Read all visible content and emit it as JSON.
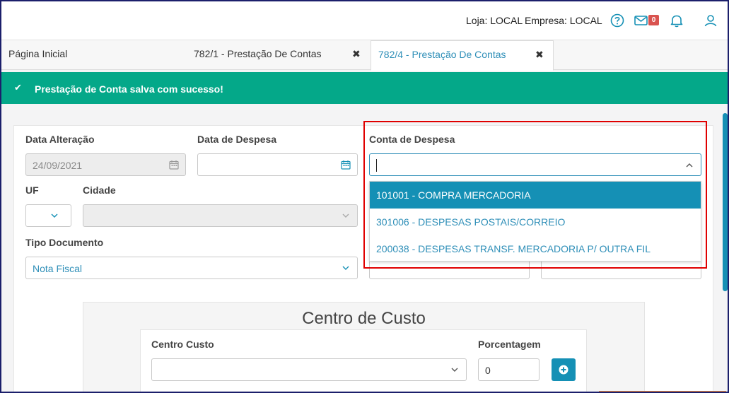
{
  "header": {
    "store_label": "Loja: LOCAL",
    "company_label": "Empresa: LOCAL",
    "mail_count": "0",
    "icons": [
      "help-icon",
      "mail-icon",
      "bell-icon",
      "user-icon"
    ]
  },
  "tabs": [
    {
      "label": "Página Inicial",
      "closable": false
    },
    {
      "label": "782/1 - Prestação De Contas",
      "closable": true
    },
    {
      "label": "782/4 - Prestação De Contas",
      "closable": true,
      "active": true
    }
  ],
  "banner": {
    "message": "Prestação de Conta salva com sucesso!",
    "color": "#04a889"
  },
  "form": {
    "data_alteracao_label": "Data Alteração",
    "data_alteracao_value": "24/09/2021",
    "data_despesa_label": "Data de Despesa",
    "data_despesa_value": "",
    "conta_despesa_label": "Conta de Despesa",
    "conta_despesa_value": "",
    "uf_label": "UF",
    "uf_value": "",
    "cidade_label": "Cidade",
    "cidade_value": "",
    "tipo_documento_label": "Tipo Documento",
    "tipo_documento_value": "Nota Fiscal"
  },
  "conta_options": [
    {
      "label": "101001 - COMPRA MERCADORIA",
      "selected": true
    },
    {
      "label": "301006 - DESPESAS POSTAIS/CORREIO",
      "selected": false
    },
    {
      "label": "200038 - DESPESAS TRANSF. MERCADORIA P/ OUTRA FIL",
      "selected": false
    }
  ],
  "centro_custo": {
    "title": "Centro de Custo",
    "centro_label": "Centro Custo",
    "centro_value": "",
    "porcentagem_label": "Porcentagem",
    "porcentagem_value": "0"
  },
  "colors": {
    "accent": "#1590b5",
    "link": "#2f8fb8",
    "highlight_box": "#e00000"
  }
}
